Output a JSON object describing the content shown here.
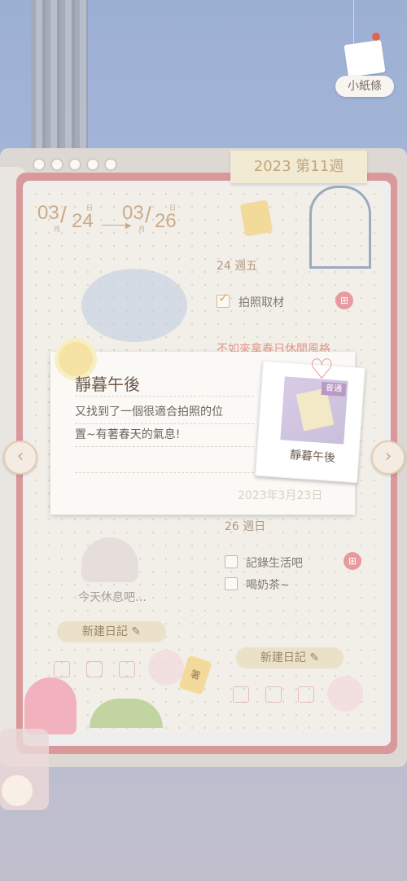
{
  "note_tag": {
    "label": "小紙條"
  },
  "week": {
    "label": "2023 第11週"
  },
  "date_range": {
    "start_month": "03",
    "start_day": "24",
    "end_month": "03",
    "end_day": "26",
    "month_unit": "月",
    "day_unit": "日"
  },
  "days": [
    {
      "label": "24  週五",
      "tasks": [
        {
          "text": "拍照取材",
          "checked": true
        }
      ],
      "extra_task": "不如來拿春日休閒風格"
    },
    {
      "label": "26  週日",
      "tasks": [
        {
          "text": "記錄生活吧",
          "checked": false
        },
        {
          "text": "喝奶茶~",
          "checked": false
        }
      ]
    }
  ],
  "left_day": {
    "rest_text": "今天休息吧…",
    "new_diary_label": "新建日記"
  },
  "right_day": {
    "new_diary_label": "新建日記"
  },
  "popup": {
    "title": "靜暮午後",
    "text_line1": "又找到了一個很適合拍照的位",
    "text_line2": "置~有著春天的氣息!",
    "date": "2023年3月23日",
    "photo_badge": "普通",
    "photo_label": "靜暮午後"
  },
  "can_text": "署",
  "colors": {
    "frame": "#d48a8b",
    "accent": "#c4a079",
    "gift": "#e48d92"
  },
  "icons": [
    "gift-icon",
    "edit-icon",
    "chevron-left-icon",
    "chevron-right-icon",
    "heart-icon",
    "sun-icon"
  ]
}
